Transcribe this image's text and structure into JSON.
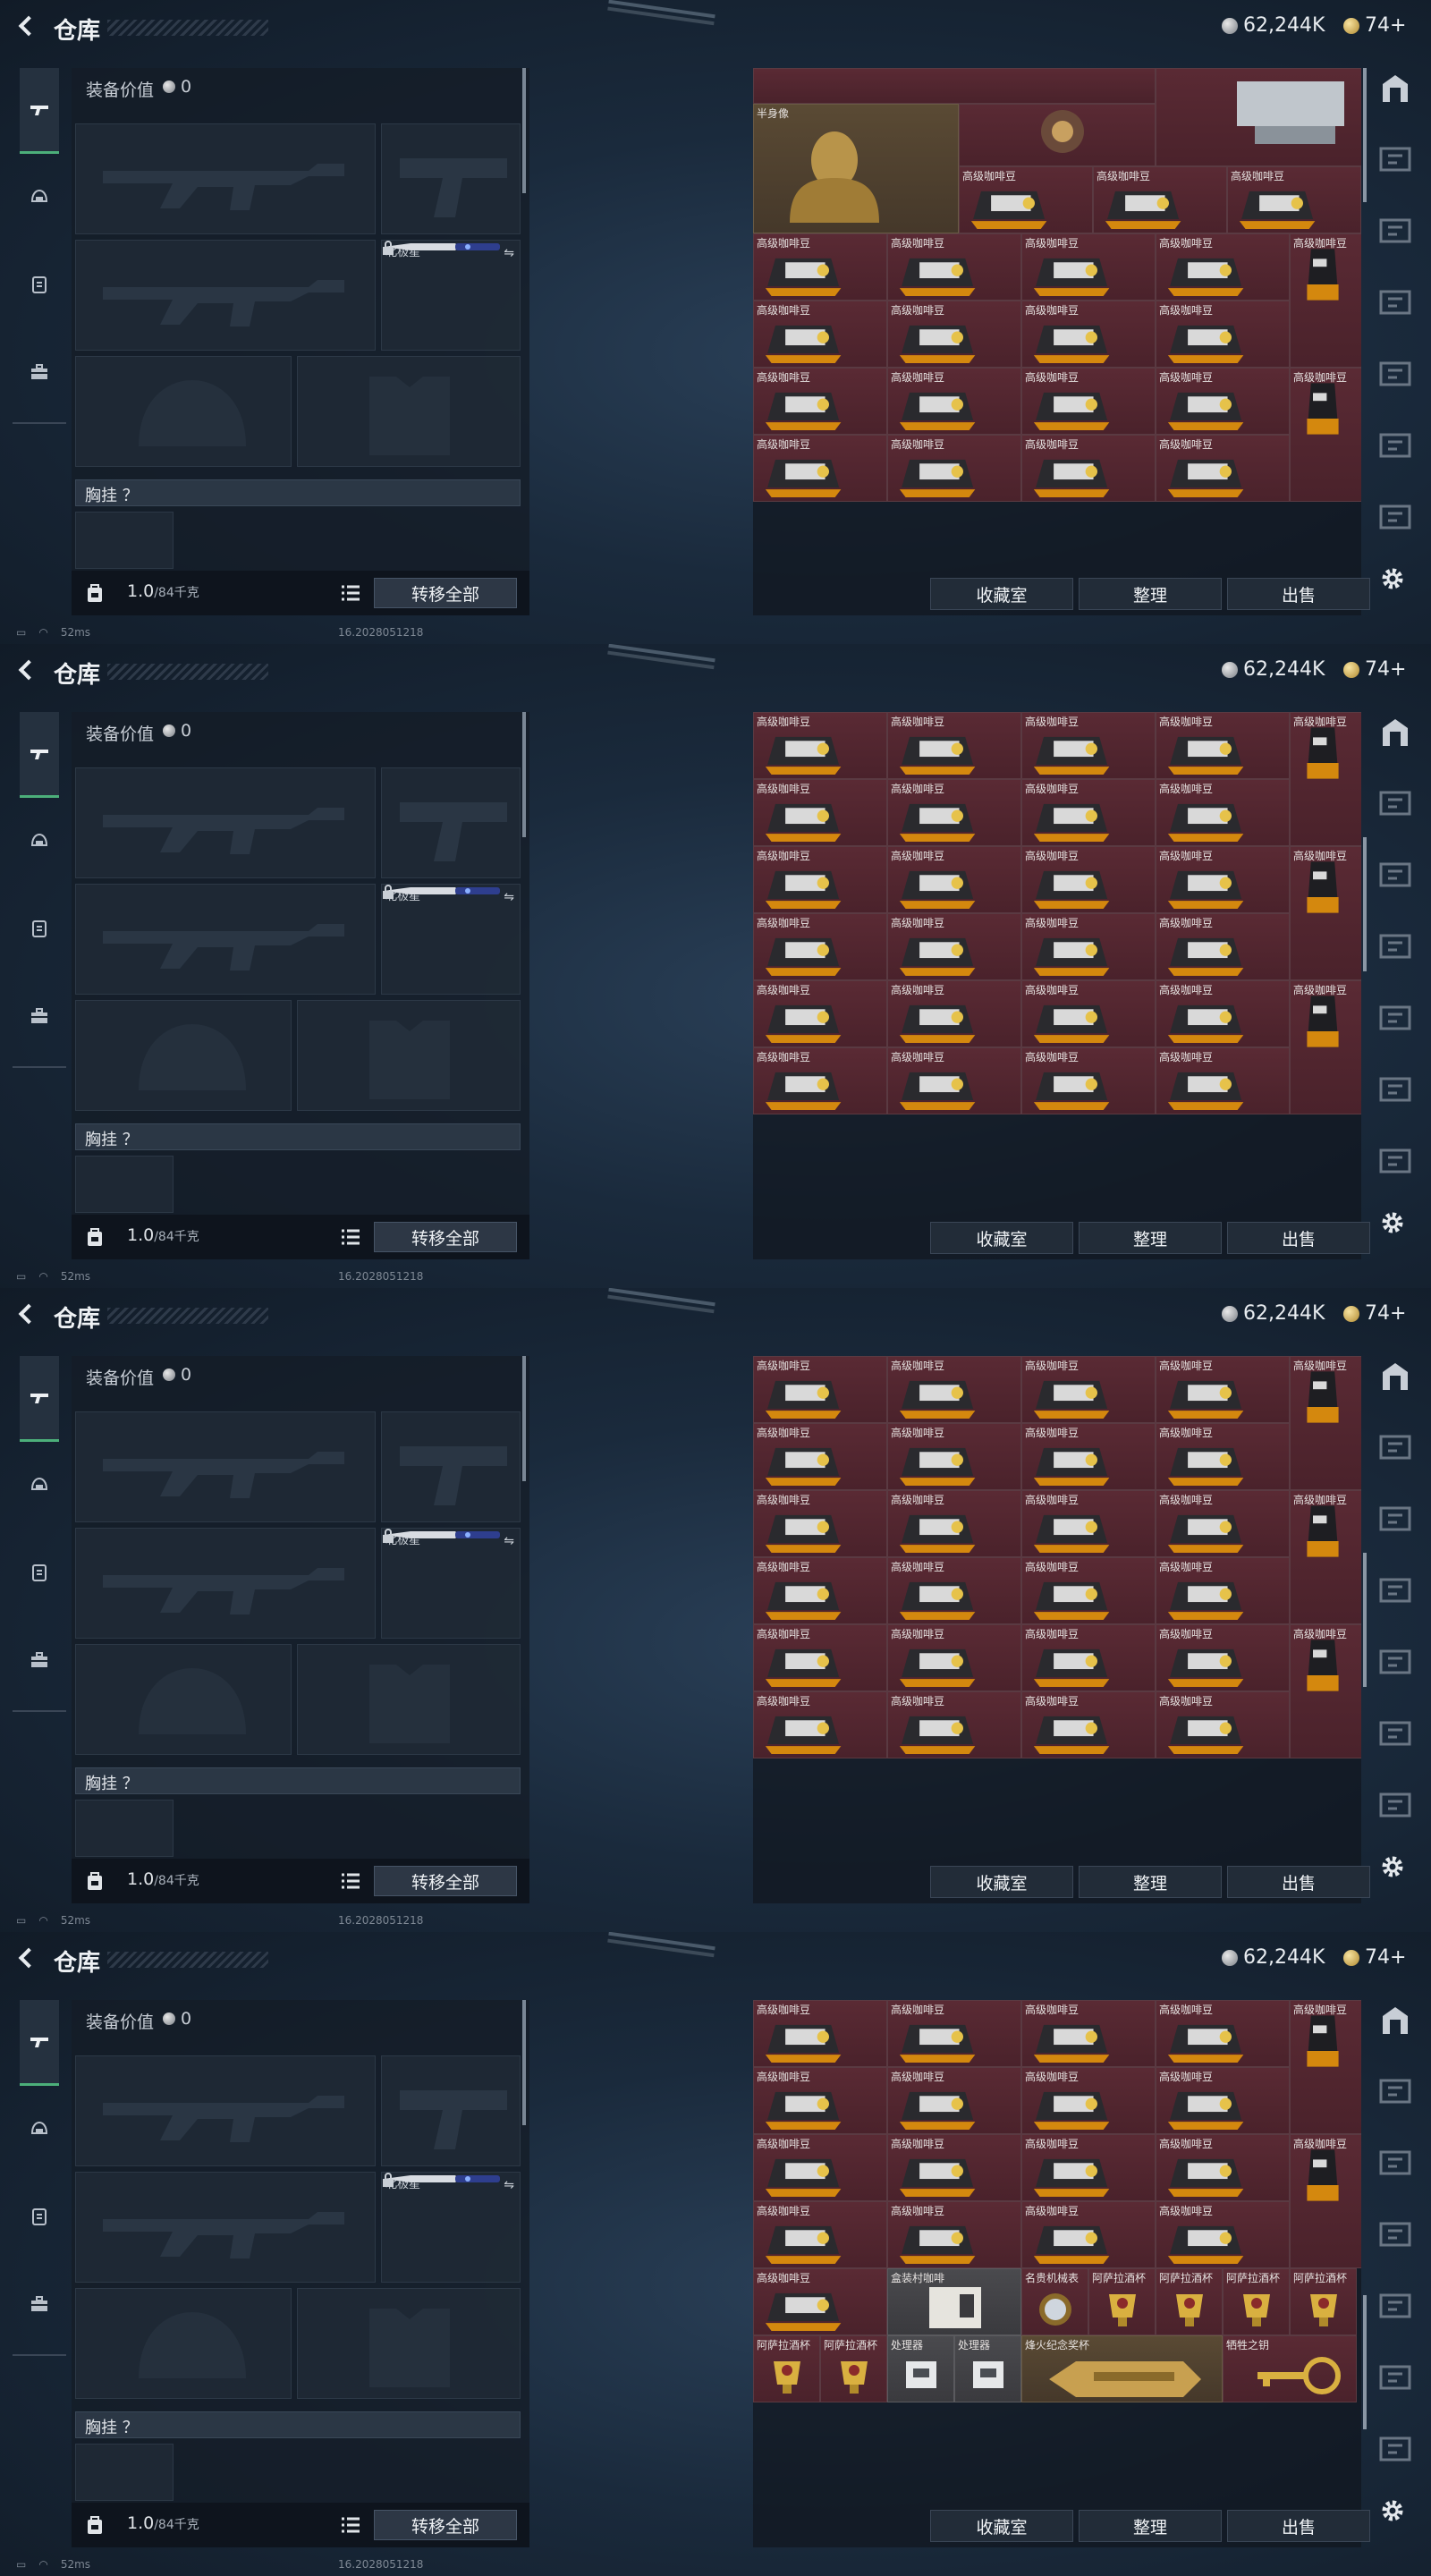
{
  "header": {
    "title": "仓库",
    "silver_amount": "62,244K",
    "gold_amount": "74+"
  },
  "sidebar": {
    "icons": [
      "gun-icon",
      "helmet-icon",
      "vest-icon",
      "briefcase-icon"
    ]
  },
  "equipment": {
    "label": "装备价值",
    "value": "0",
    "melee_slot_name": "北极星",
    "rig_label": "胸挂 ？",
    "weight": "1.0",
    "weight_limit": "/84千克",
    "transfer_all": "转移全部"
  },
  "stash_buttons": {
    "collection": "收藏室",
    "sort": "整理",
    "sell": "出售"
  },
  "status": {
    "ping": "52ms",
    "build": "16.2028051218"
  },
  "items": {
    "bust": "半身像",
    "coffee": "高级咖啡豆",
    "box": "盒装村咖啡",
    "coffee_machine": "名贵机械表",
    "cup": "阿萨拉酒杯",
    "processor": "处理器",
    "trophy": "烽火纪念奖杯",
    "key": "牺牲之钥"
  },
  "colors": {
    "accent_green": "#4caf7a",
    "cell_red": "#4a222b",
    "cell_gold": "#45382a"
  },
  "panels": [
    {
      "id": "panel-1",
      "variant": "top"
    },
    {
      "id": "panel-2",
      "variant": "mid"
    },
    {
      "id": "panel-3",
      "variant": "mid"
    },
    {
      "id": "panel-4",
      "variant": "bottom"
    }
  ]
}
